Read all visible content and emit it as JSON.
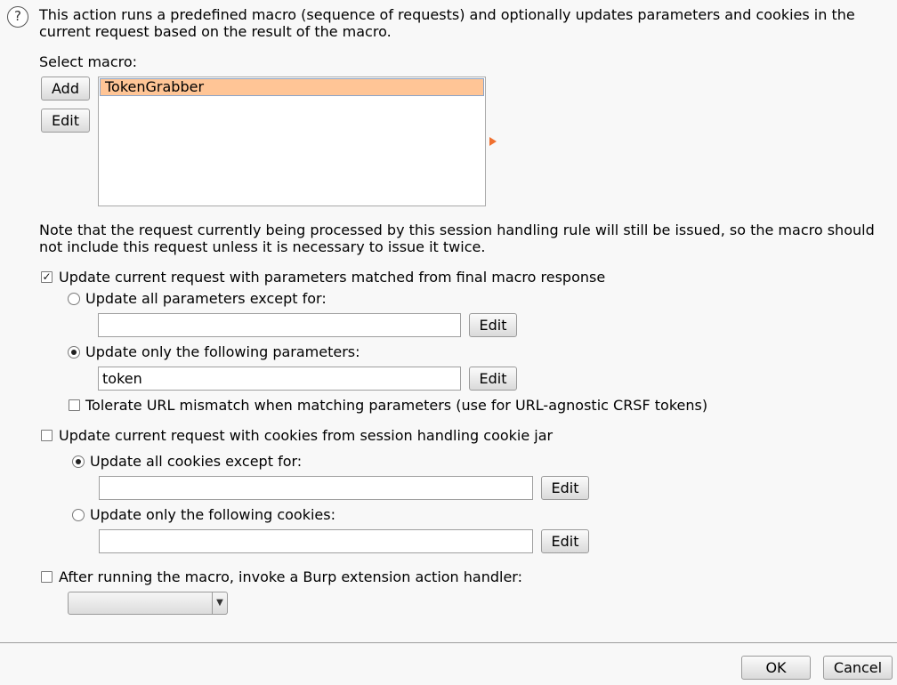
{
  "description": {
    "line1": "This action runs a predefined macro (sequence of requests) and optionally updates parameters and cookies in the",
    "line2": "current request based on the result of the macro."
  },
  "macro": {
    "label": "Select macro:",
    "add_label": "Add",
    "edit_label": "Edit",
    "items": [
      "TokenGrabber"
    ],
    "selected": "TokenGrabber"
  },
  "note": {
    "line1": "Note that the request currently being processed by this session handling rule will still be issued, so the macro should",
    "line2": "not include this request unless it is necessary to issue it twice."
  },
  "params": {
    "checkbox_label": "Update current request with parameters matched from final macro response",
    "checked": true,
    "except_label": "Update all parameters except for:",
    "except_value": "",
    "except_edit": "Edit",
    "only_label": "Update only the following parameters:",
    "only_value": "token",
    "only_edit": "Edit",
    "selected_option": "only",
    "tolerate_label": "Tolerate URL mismatch when matching parameters (use for URL-agnostic CRSF tokens)",
    "tolerate_checked": false
  },
  "cookies": {
    "checkbox_label": "Update current request with cookies from session handling cookie jar",
    "checked": false,
    "except_label": "Update all cookies except for:",
    "except_value": "",
    "except_edit": "Edit",
    "only_label": "Update only the following cookies:",
    "only_value": "",
    "only_edit": "Edit",
    "selected_option": "except"
  },
  "extension": {
    "checkbox_label": "After running the macro, invoke a Burp extension action handler:",
    "checked": false,
    "handler_value": ""
  },
  "footer": {
    "ok_label": "OK",
    "cancel_label": "Cancel"
  },
  "icons": {
    "help": "?",
    "check": "✓",
    "combo_arrow": "▼"
  },
  "colors": {
    "selection": "#ffc596",
    "accent_arrow": "#f07030"
  }
}
